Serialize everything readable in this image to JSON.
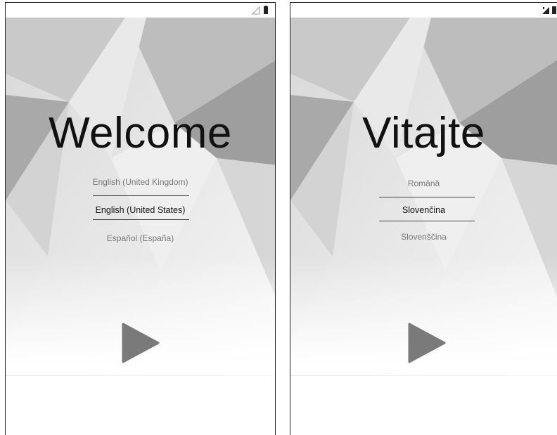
{
  "left_screen": {
    "headline": "Welcome",
    "languages": [
      {
        "label": "English (United Kingdom)",
        "selected": false
      },
      {
        "label": "English (United States)",
        "selected": true
      },
      {
        "label": "Español (España)",
        "selected": false
      }
    ],
    "status_icons": [
      "signal-icon",
      "battery-icon"
    ],
    "start_button_icon": "play-icon"
  },
  "right_screen": {
    "headline": "Vitajte",
    "languages": [
      {
        "label": "Română",
        "selected": false
      },
      {
        "label": "Slovenčina",
        "selected": true
      },
      {
        "label": "Slovenščina",
        "selected": false
      }
    ],
    "status_icons": [
      "signal-icon",
      "battery-icon"
    ],
    "start_button_icon": "play-icon"
  },
  "colors": {
    "play": "#7a7a7a",
    "divider": "#444444",
    "bg_light": "#f2f2f2",
    "bg_dark": "#9a9a9a"
  }
}
